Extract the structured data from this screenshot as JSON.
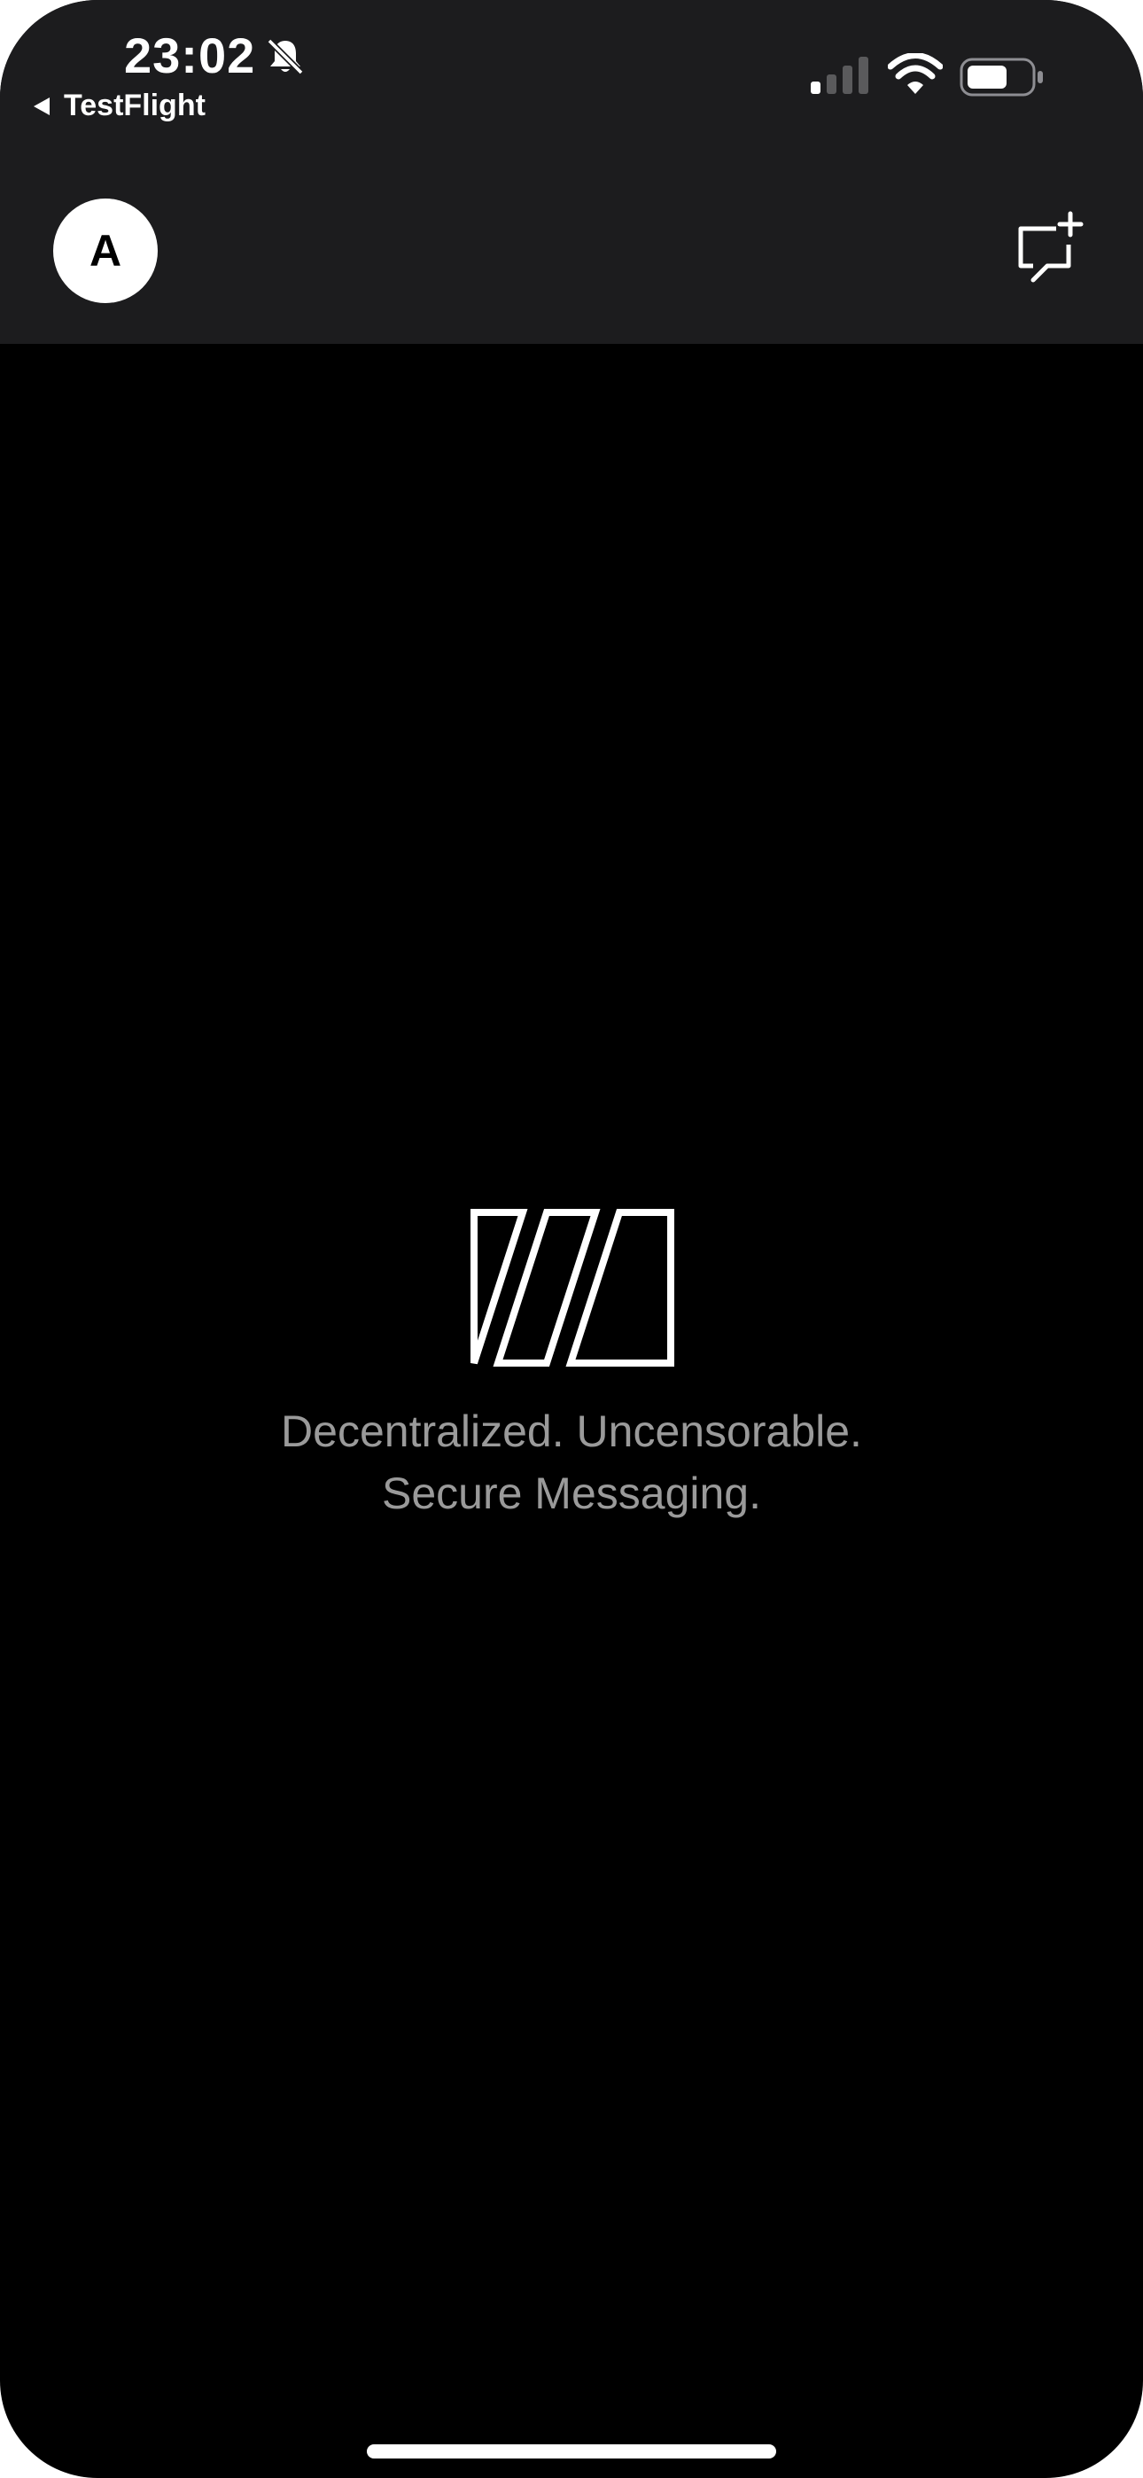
{
  "status_bar": {
    "time": "23:02",
    "back_label": "TestFlight",
    "icons": [
      "bell-slash-icon",
      "signal-icon",
      "wifi-icon",
      "battery-icon"
    ]
  },
  "header": {
    "avatar_initial": "A",
    "new_chat_icon": "new-chat-icon"
  },
  "main": {
    "logo_icon": "app-logo-icon",
    "tagline_line1": "Decentralized. Uncensorable.",
    "tagline_line2": "Secure Messaging."
  },
  "colors": {
    "background": "#000000",
    "header_background": "#1c1c1e",
    "tagline_text": "#9a9a9a",
    "foreground": "#ffffff"
  }
}
